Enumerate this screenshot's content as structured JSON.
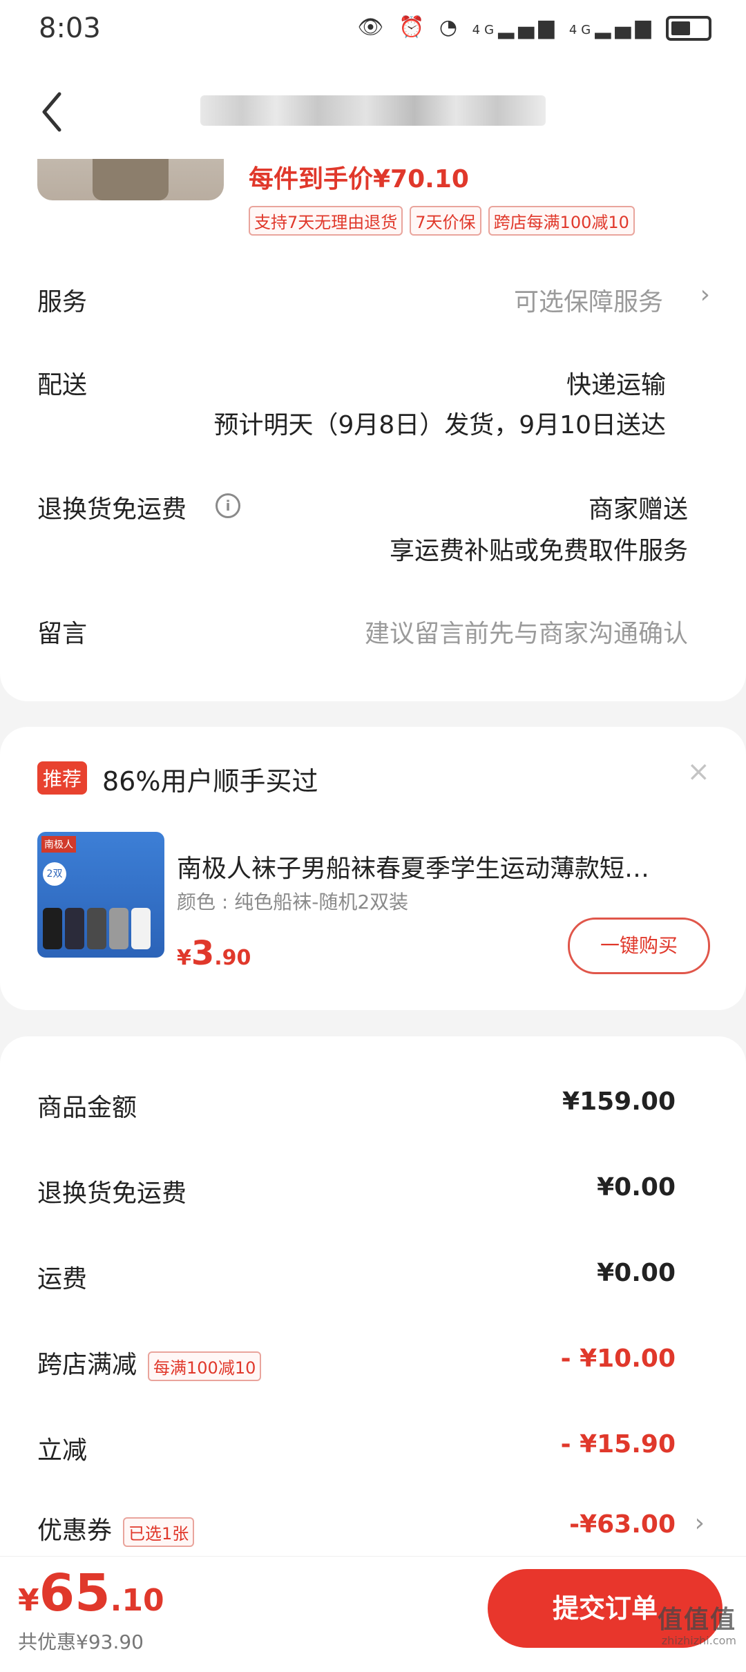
{
  "status_bar": {
    "time": "8:03",
    "network_left": "4G",
    "network_right": "4G"
  },
  "product": {
    "unit_price_label": "每件到手价¥70.10",
    "tags": [
      "支持7天无理由退货",
      "7天价保",
      "跨店每满100减10"
    ]
  },
  "order_rows": {
    "service_label": "服务",
    "service_value": "可选保障服务",
    "delivery_label": "配送",
    "delivery_method": "快递运输",
    "delivery_eta": "预计明天（9月8日）发货，9月10日送达",
    "return_shipping_label": "退换货免运费",
    "return_shipping_value": "商家赠送",
    "return_shipping_desc": "享运费补贴或免费取件服务",
    "message_label": "留言",
    "message_placeholder": "建议留言前先与商家沟通确认"
  },
  "recommendation": {
    "badge": "推荐",
    "title": "86%用户顺手买过",
    "product_name": "南极人袜子男船袜春夏季学生运动薄款短…",
    "spec": "颜色 : 纯色船袜-随机2双装",
    "price_symbol": "¥",
    "price_int": "3",
    "price_dec": ".90",
    "buy_button": "一键购买",
    "img_brand": "南极人",
    "img_count": "2双"
  },
  "summary": {
    "goods_label": "商品金额",
    "goods_value": "¥159.00",
    "return_label": "退换货免运费",
    "return_value": "¥0.00",
    "shipping_label": "运费",
    "shipping_value": "¥0.00",
    "cross_store_label": "跨店满减",
    "cross_store_tag": "每满100减10",
    "cross_store_value": "- ¥10.00",
    "instant_label": "立减",
    "instant_value": "- ¥15.90",
    "coupon_label": "优惠券",
    "coupon_tag": "已选1张",
    "coupon_value": "-¥63.00"
  },
  "bottom": {
    "total_symbol": "¥",
    "total_int": "65",
    "total_dec": ".10",
    "total_discount": "共优惠¥93.90",
    "submit_button": "提交订单",
    "watermark": "值值值",
    "watermark_sub": "zhizhizhi.com"
  },
  "colors": {
    "accent": "#e8362c",
    "price_red": "#e0382b"
  }
}
